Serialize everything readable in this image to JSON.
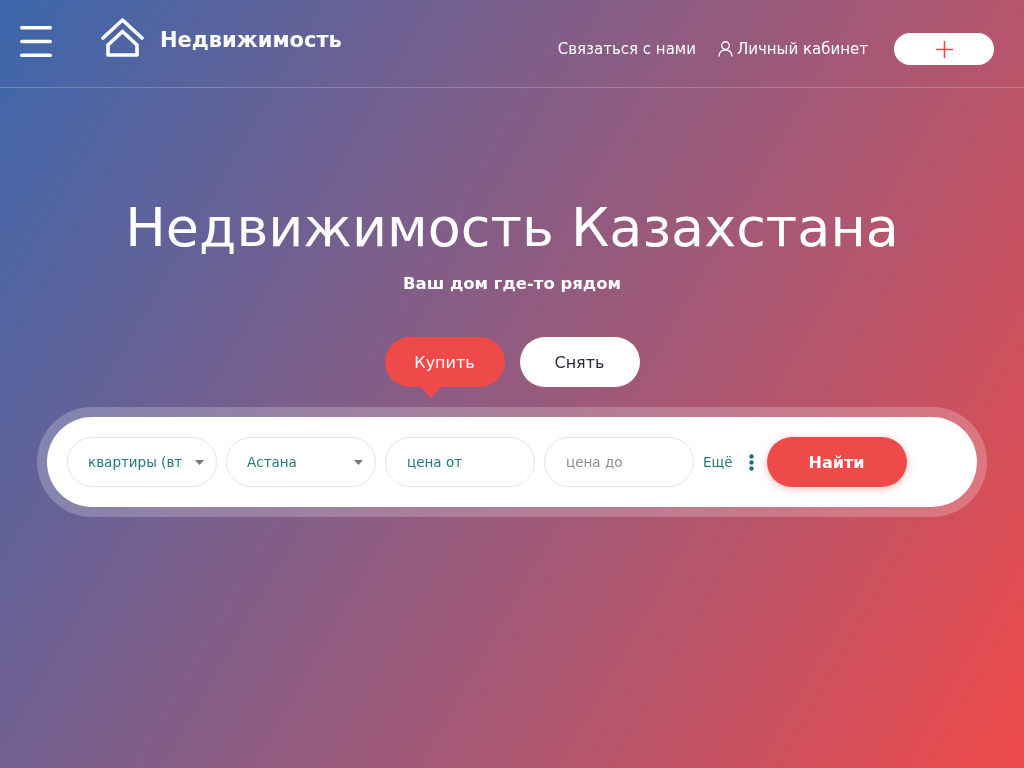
{
  "header": {
    "brand": "Недвижимость",
    "links": [
      {
        "kind": "link",
        "label": "Связаться с нами"
      },
      {
        "kind": "account",
        "label": "Личный кабинет"
      }
    ]
  },
  "hero": {
    "title": "Недвижимость Казахстана",
    "subtitle": "Ваш дом где-то рядом"
  },
  "tabs": [
    {
      "label": "Купить",
      "selected": true
    },
    {
      "label": "Снять",
      "selected": false
    }
  ],
  "search": {
    "fields": [
      {
        "kind": "select",
        "value": "квартиры (вт"
      },
      {
        "kind": "select",
        "value": "Астана"
      },
      {
        "kind": "input",
        "value": "цена от"
      },
      {
        "kind": "input",
        "placeholder": "цена до"
      }
    ],
    "more": "Ещё",
    "submit": "Найти"
  }
}
